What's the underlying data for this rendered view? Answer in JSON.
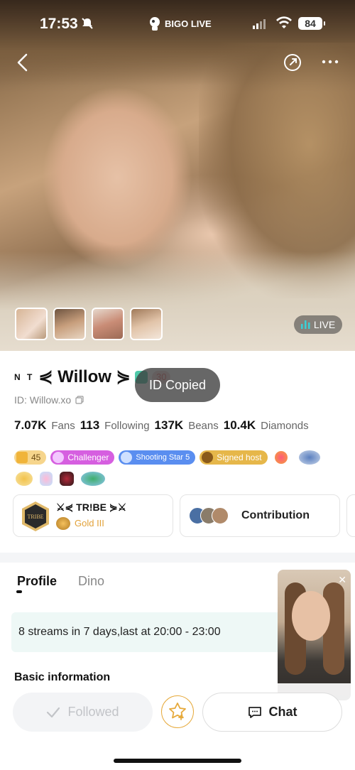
{
  "status_bar": {
    "time": "17:53",
    "battery": "84",
    "brand": "BIGO LIVE"
  },
  "live_badge": "LIVE",
  "profile": {
    "prefix": "N T",
    "username": "⋞ Willow ⋟",
    "level": "30",
    "id_line": "ID: Willow.xo",
    "toast": "ID Copied"
  },
  "stats": [
    {
      "value": "7.07K",
      "label": "Fans"
    },
    {
      "value": "113",
      "label": "Following"
    },
    {
      "value": "137K",
      "label": "Beans"
    },
    {
      "value": "10.4K",
      "label": "Diamonds"
    }
  ],
  "badges": {
    "level_value": "45",
    "challenger": "Challenger",
    "shooting_star": "Shooting Star 5",
    "signed_host": "Signed host"
  },
  "tribe": {
    "name": "⚔⋞ TR!BE ⋟⚔",
    "rank": "Gold III",
    "emblem": "TRIBE"
  },
  "contribution": {
    "label": "Contribution"
  },
  "tabs": [
    "Profile",
    "Dino"
  ],
  "streams_info": "8 streams in 7 days,last at 20:00 - 23:00",
  "basic_info": "Basic information",
  "actions": {
    "followed": "Followed",
    "chat": "Chat"
  },
  "colors": {
    "accent_gold": "#e6a93a",
    "challenger": "#d65fe0",
    "shooting_star": "#5a8ef0",
    "signed_host": "#e6b74a"
  }
}
